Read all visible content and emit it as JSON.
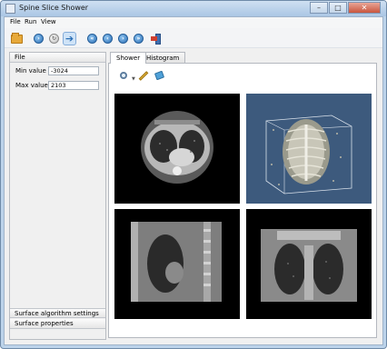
{
  "window": {
    "title": "Spine Slice Shower"
  },
  "menu": {
    "file": "File",
    "run": "Run",
    "view": "View"
  },
  "left": {
    "section_file": "File",
    "min_label": "Min value",
    "min_value": "-3024",
    "max_label": "Max value",
    "max_value": "2103",
    "section_surface_algo": "Surface algorithm settings",
    "section_surface_props": "Surface properties"
  },
  "tabs": {
    "shower": "Shower",
    "histogram": "Histogram"
  },
  "colors": {
    "titlebar": "#bcd3ea",
    "render_bg": "#3d5a7d",
    "accent": "#2b6fb5"
  }
}
